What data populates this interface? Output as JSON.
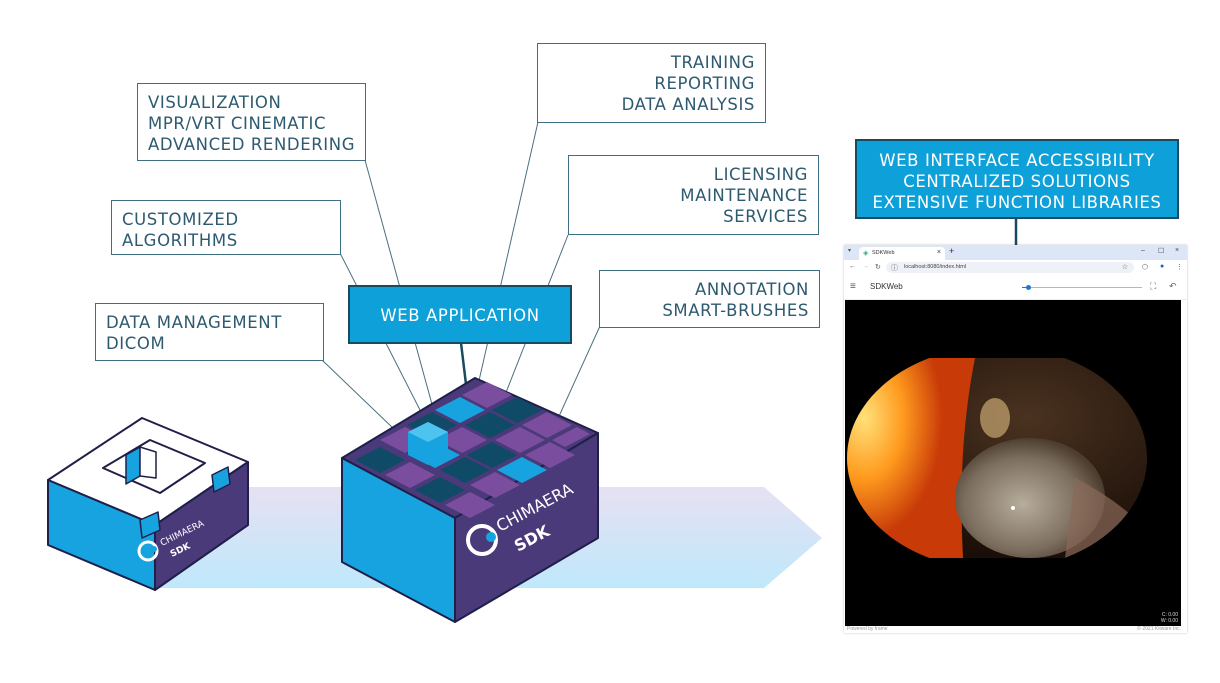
{
  "labels": {
    "visualization": [
      "VISUALIZATION",
      "MPR/VRT CINEMATIC",
      "ADVANCED RENDERING"
    ],
    "customized": [
      "CUSTOMIZED",
      "ALGORITHMS"
    ],
    "data_management": [
      "DATA MANAGEMENT",
      "DICOM"
    ],
    "training": [
      "TRAINING",
      "REPORTING",
      "DATA ANALYSIS"
    ],
    "licensing": [
      "LICENSING",
      "MAINTENANCE",
      "SERVICES"
    ],
    "annotation": [
      "ANNOTATION",
      "SMART-BRUSHES"
    ],
    "web_application": "WEB APPLICATION",
    "web_interface": [
      "WEB INTERFACE ACCESSIBILITY",
      "CENTRALIZED SOLUTIONS",
      "EXTENSIVE FUNCTION LIBRARIES"
    ]
  },
  "boxes": {
    "small": {
      "brand": "CHIMAERA",
      "product": "SDK"
    },
    "large": {
      "brand": "CHIMAERA",
      "product": "SDK"
    }
  },
  "colors": {
    "accent_blue": "#0ea0d8",
    "dark_teal": "#1a4a60",
    "purple": "#4a3a7a",
    "label_text": "#2e5a70"
  },
  "browser": {
    "tab_title": "SDKWeb",
    "url": "localhost:8080/index.html",
    "app_title": "SDKWeb",
    "slider_value": 0.05,
    "overlay_c": "C: 0.00",
    "overlay_w": "W: 0.00",
    "footer_left": "Powered by frame",
    "footer_right": "© 2021 Kitware Inc.",
    "icons": {
      "tab_menu": "▾",
      "favicon": "◈",
      "tab_close": "×",
      "new_tab": "+",
      "minimize": "–",
      "maximize": "☐",
      "close": "×",
      "back": "←",
      "forward": "→",
      "reload": "↻",
      "info": "ⓘ",
      "star": "☆",
      "extensions": "⬡",
      "profile": "●",
      "more": "⋮",
      "menu": "≡",
      "fullscreen": "⛶",
      "undo": "↶"
    }
  }
}
